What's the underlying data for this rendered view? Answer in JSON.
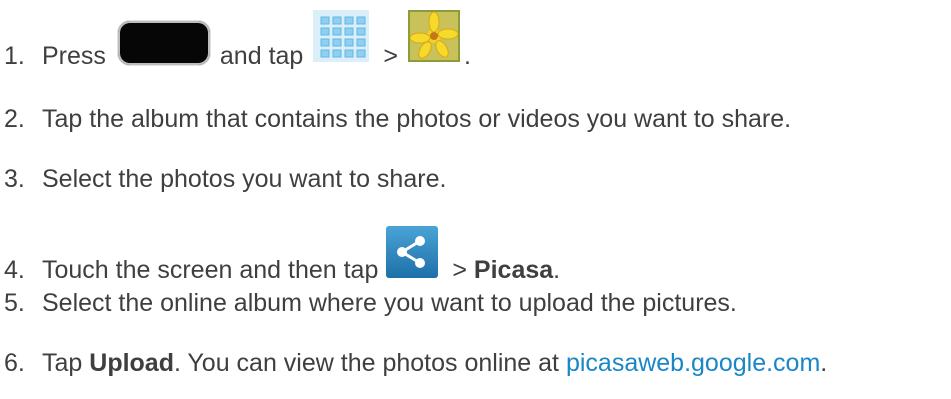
{
  "steps": [
    {
      "num": "1.",
      "before": "Press",
      "mid": "and tap",
      "sep": ">",
      "after": ".",
      "icons": [
        "home-button",
        "apps-icon",
        "gallery-icon"
      ]
    },
    {
      "num": "2.",
      "text": "Tap the album that contains the photos or videos you want to share."
    },
    {
      "num": "3.",
      "text": "Select the photos you want to share."
    },
    {
      "num": "4.",
      "before": "Touch the screen and then tap",
      "sep": ">",
      "bold": "Picasa",
      "after": ".",
      "icons": [
        "share-icon"
      ]
    },
    {
      "num": "5.",
      "text": "Select the online album where you want to upload the pictures."
    },
    {
      "num": "6.",
      "before": "Tap",
      "bold": "Upload",
      "mid": ". You can view the photos online at",
      "link": "picasaweb.google.com",
      "after": "."
    }
  ],
  "colors": {
    "text": "#3f3f3f",
    "link": "#1a86c8"
  }
}
